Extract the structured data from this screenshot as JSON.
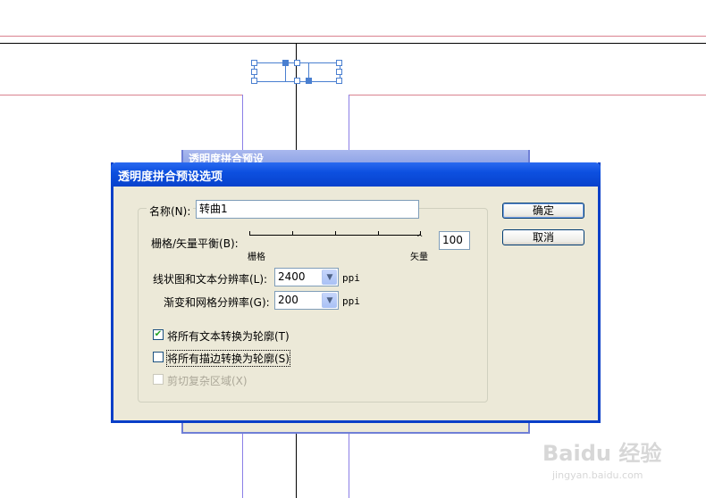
{
  "back_dialog": {
    "title": "透明度拼合预设"
  },
  "dialog": {
    "title": "透明度拼合预设选项",
    "name_label": "名称(N):",
    "name_value": "转曲1",
    "balance_label": "栅格/矢量平衡(B):",
    "balance_left": "栅格",
    "balance_right": "矢量",
    "balance_value": "100",
    "line_art_label": "线状图和文本分辨率(L):",
    "line_art_value": "2400",
    "line_art_unit": "ppi",
    "gradient_label": "渐变和网格分辨率(G):",
    "gradient_value": "200",
    "gradient_unit": "ppi",
    "convert_text_label": "将所有文本转换为轮廓(T)",
    "convert_text_checked": true,
    "convert_strokes_label": "将所有描边转换为轮廓(S)",
    "convert_strokes_checked": false,
    "clip_complex_label": "剪切复杂区域(X)",
    "clip_complex_checked": false,
    "ok_label": "确定",
    "cancel_label": "取消"
  },
  "watermark": {
    "brand": "Baidu 经验",
    "url": "jingyan.baidu.com"
  },
  "colors": {
    "title_bar": "#0842cc",
    "dialog_bg": "#ece9d8",
    "guide_red": "#d9828f",
    "guide_blue": "#8b7fe6"
  }
}
